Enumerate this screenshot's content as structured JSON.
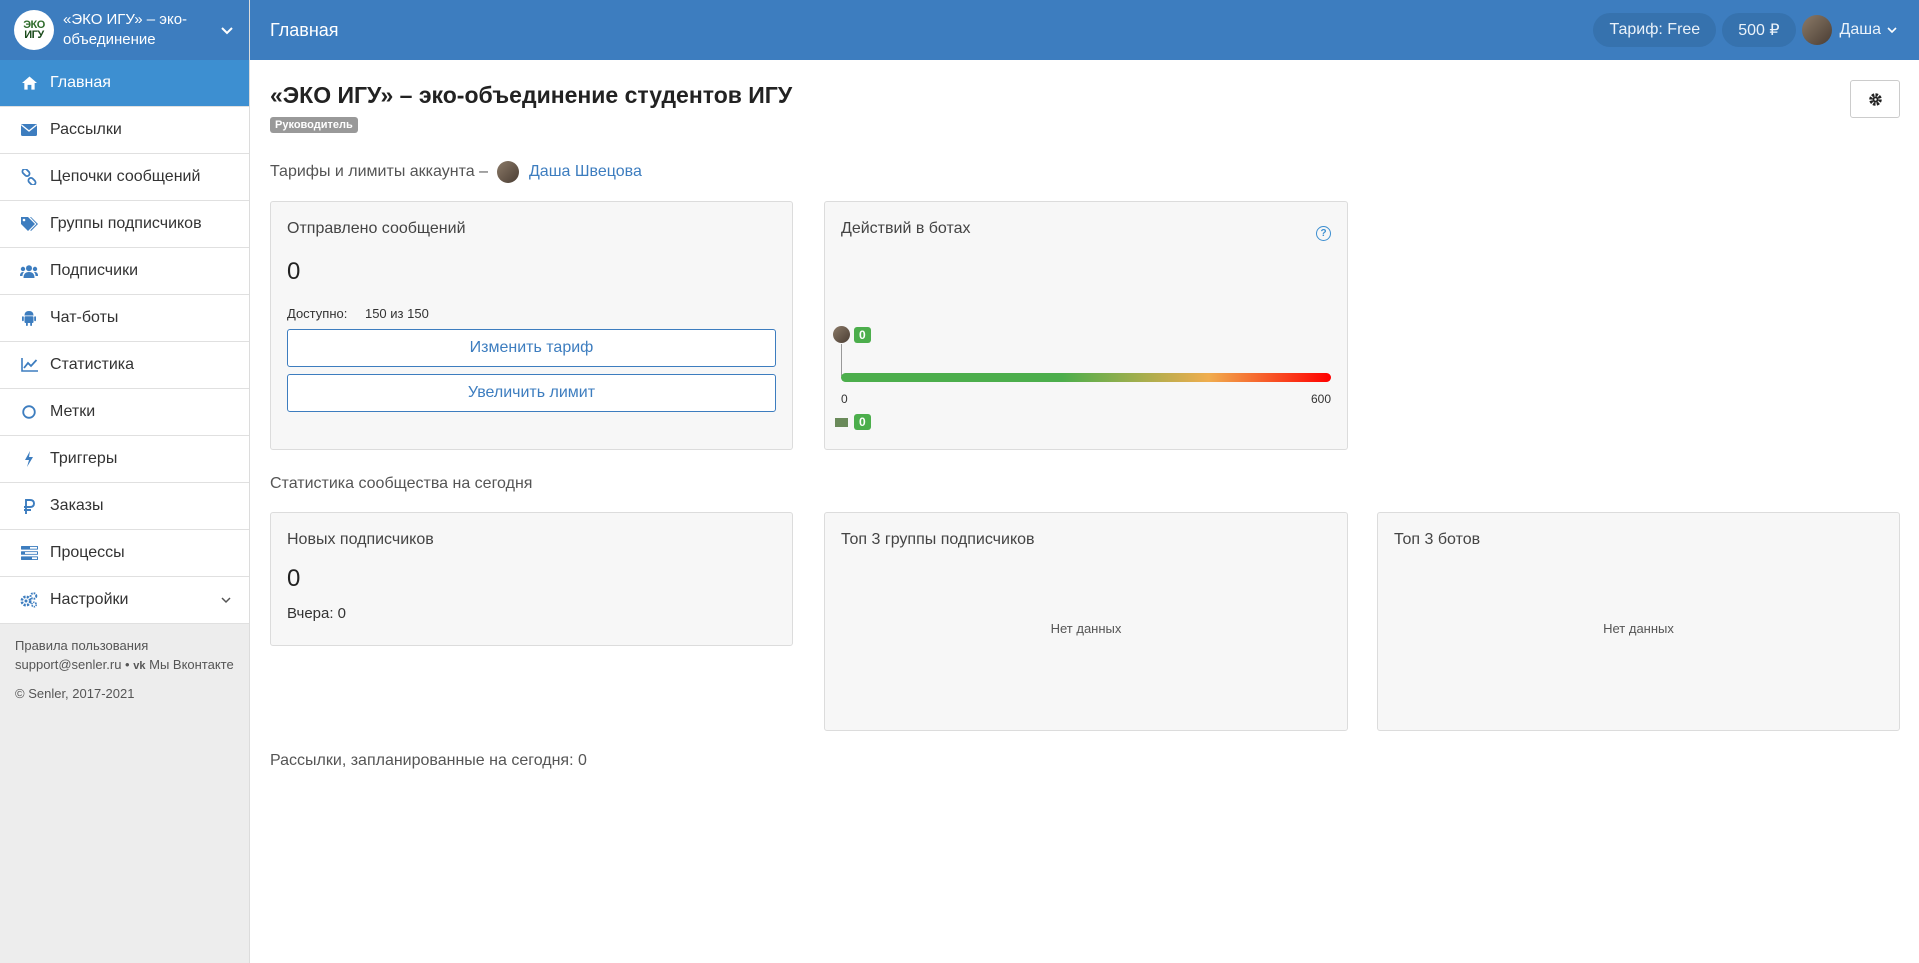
{
  "sidebar": {
    "brand_name": "«ЭКО ИГУ» – эко-объединение",
    "logo_line1": "ЭКО",
    "logo_line2": "ИГУ",
    "items": [
      {
        "label": "Главная",
        "icon": "home-icon"
      },
      {
        "label": "Рассылки",
        "icon": "envelope-icon"
      },
      {
        "label": "Цепочки сообщений",
        "icon": "link-icon"
      },
      {
        "label": "Группы подписчиков",
        "icon": "tags-icon"
      },
      {
        "label": "Подписчики",
        "icon": "users-icon"
      },
      {
        "label": "Чат-боты",
        "icon": "android-icon"
      },
      {
        "label": "Статистика",
        "icon": "chart-line-icon"
      },
      {
        "label": "Метки",
        "icon": "circle-icon"
      },
      {
        "label": "Триггеры",
        "icon": "bolt-icon"
      },
      {
        "label": "Заказы",
        "icon": "ruble-icon"
      },
      {
        "label": "Процессы",
        "icon": "tasks-icon"
      },
      {
        "label": "Настройки",
        "icon": "cogs-icon"
      }
    ],
    "footer": {
      "terms": "Правила пользования",
      "email": "support@senler.ru",
      "separator": "•",
      "vk": "Мы Вконтакте",
      "copyright": "© Senler, 2017-2021"
    }
  },
  "topbar": {
    "title": "Главная",
    "tariff": "Тариф: Free",
    "balance": "500 ₽",
    "user_name": "Даша"
  },
  "main": {
    "page_title": "«ЭКО ИГУ» – эко-объединение студентов ИГУ",
    "role_badge": "Руководитель",
    "tariffs_label": "Тарифы и лимиты аккаунта –",
    "owner_name": "Даша Швецова",
    "messages_card": {
      "title": "Отправлено сообщений",
      "value": "0",
      "available_label": "Доступно:",
      "available_value": "150 из 150",
      "change_tariff": "Изменить тариф",
      "increase_limit": "Увеличить лимит"
    },
    "bot_actions_card": {
      "title": "Действий в ботах",
      "help": "?",
      "top_badge": "0",
      "bottom_badge": "0",
      "scale_min": "0",
      "scale_max": "600",
      "progress": 0
    },
    "community_stats_label": "Статистика сообщества на сегодня",
    "new_subscribers_card": {
      "title": "Новых подписчиков",
      "value": "0",
      "yesterday": "Вчера: 0"
    },
    "top_groups_card": {
      "title": "Топ 3 группы подписчиков",
      "empty": "Нет данных"
    },
    "top_bots_card": {
      "title": "Топ 3 ботов",
      "empty": "Нет данных"
    },
    "scheduled_label": "Рассылки, запланированные на сегодня: 0"
  },
  "colors": {
    "primary": "#3d7dbf",
    "active_nav": "#3d8fd1",
    "success": "#4cae4c",
    "gradient_start": "#4cae4c",
    "gradient_mid": "#f0ad4e",
    "gradient_end": "#ff0000"
  }
}
